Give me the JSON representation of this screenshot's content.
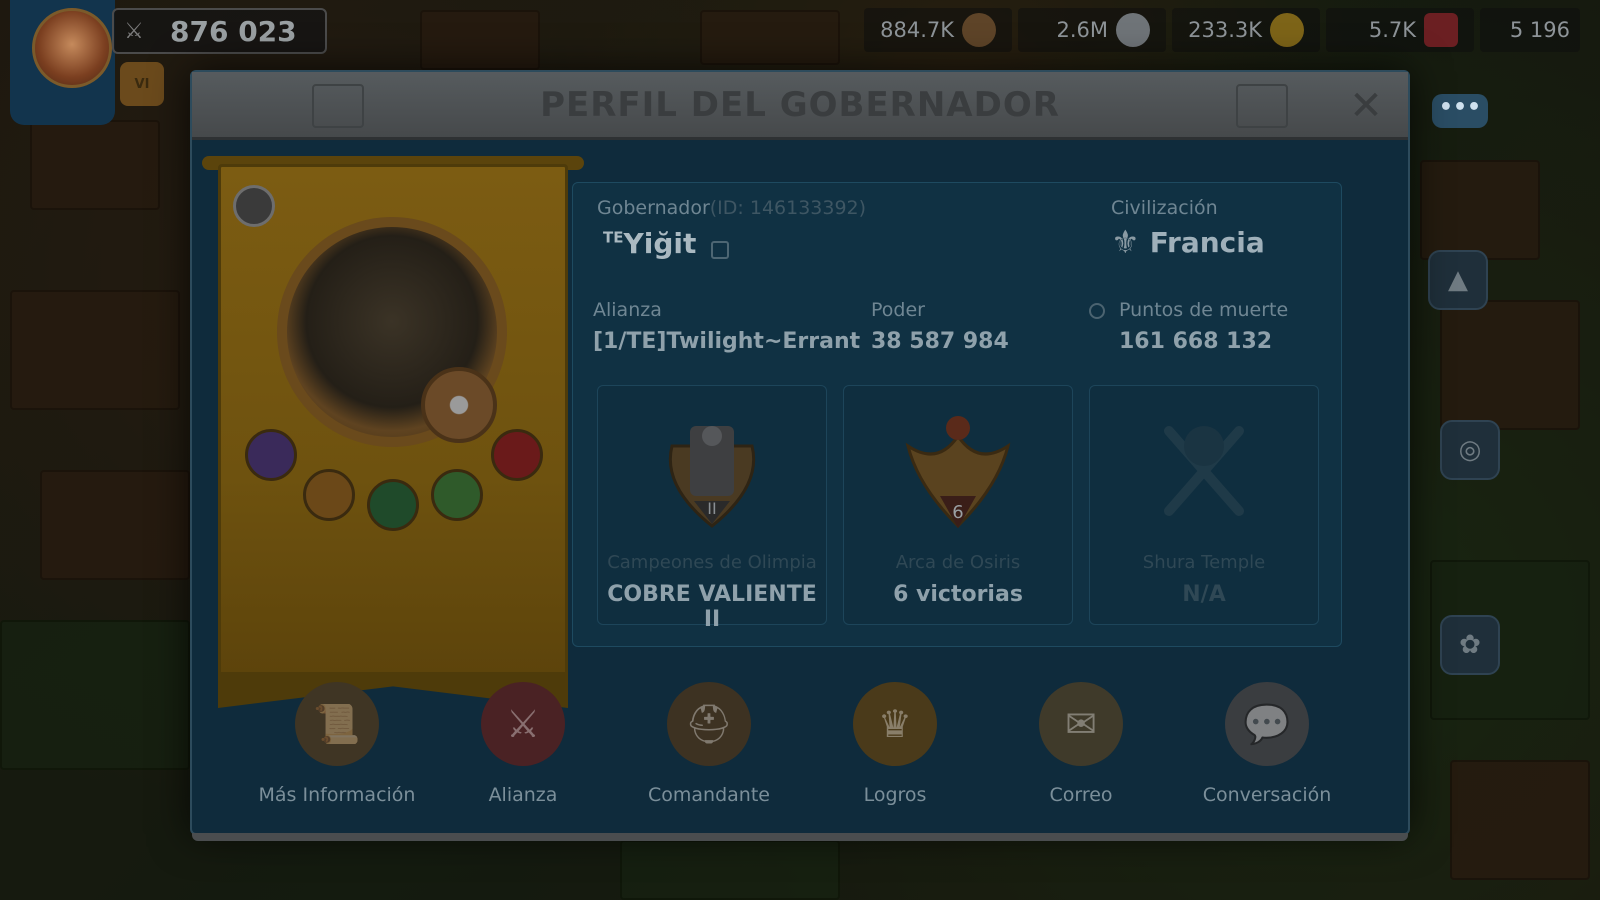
{
  "hud": {
    "power": "876 023",
    "vip_label": "VI",
    "resources": [
      {
        "name": "food",
        "value": "884.7K",
        "color": "#6d6a2a"
      },
      {
        "name": "wood",
        "value": "2.6M",
        "color": "#6a4a2a"
      },
      {
        "name": "stone",
        "value": "233.3K",
        "color": "#6f7478"
      },
      {
        "name": "gold",
        "value": "5.7K",
        "color": "#7d6418"
      },
      {
        "name": "gems",
        "value": "5 196",
        "color": "#6b1f22"
      }
    ],
    "chat": "•••"
  },
  "modal": {
    "title": "PERFIL DEL GOBERNADOR",
    "close": "✕",
    "governor_label": "Gobernador",
    "governor_id": "(ID: 146133392)",
    "governor_tag": "TE",
    "governor_name": "Yiğit",
    "civilization_label": "Civilización",
    "civilization_value": "Francia",
    "alliance_label": "Alianza",
    "alliance_value": "[1/TE]Twilight~Errant",
    "power_label": "Poder",
    "power_value": "38 587 984",
    "kill_points_label": "Puntos de muerte",
    "kill_points_value": "161 668 132",
    "cards": [
      {
        "label": "Campeones de Olimpia",
        "value": "COBRE VALIENTE II",
        "medal_text": "II"
      },
      {
        "label": "Arca de Osiris",
        "value": "6 victorias",
        "medal_text": "6"
      },
      {
        "label": "Shura Temple",
        "value": "N/A",
        "medal_text": ""
      }
    ],
    "nav": [
      {
        "label": "Más Información",
        "icon": "scroll-icon"
      },
      {
        "label": "Alianza",
        "icon": "sword-icon"
      },
      {
        "label": "Comandante",
        "icon": "helmet-icon"
      },
      {
        "label": "Logros",
        "icon": "crown-icon"
      },
      {
        "label": "Correo",
        "icon": "mail-icon"
      },
      {
        "label": "Conversación",
        "icon": "chat-icon"
      }
    ]
  }
}
